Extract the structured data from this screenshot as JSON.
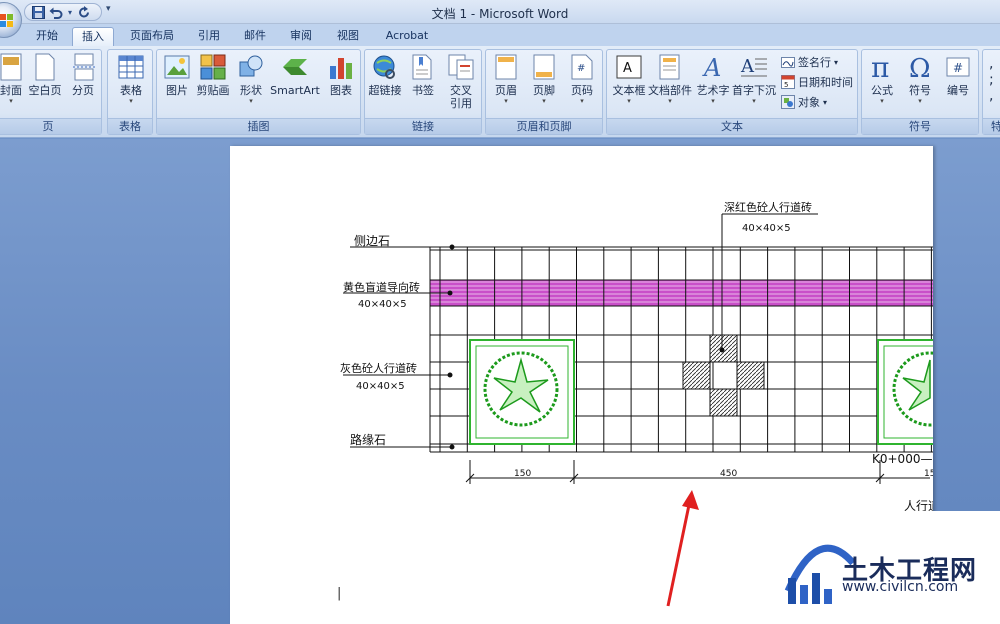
{
  "window": {
    "title": "文档 1 - Microsoft Word"
  },
  "quick_access": {
    "save": "save-icon",
    "undo": "undo-icon",
    "redo": "redo-icon",
    "more": "▾"
  },
  "tabs": [
    "开始",
    "插入",
    "页面布局",
    "引用",
    "邮件",
    "审阅",
    "视图",
    "Acrobat"
  ],
  "active_tab": "插入",
  "ribbon": {
    "pages": {
      "label": "页",
      "buttons": [
        "封面",
        "空白页",
        "分页"
      ]
    },
    "tables": {
      "label": "表格",
      "buttons": [
        "表格"
      ]
    },
    "illustrations": {
      "label": "插图",
      "buttons": [
        "图片",
        "剪贴画",
        "形状",
        "SmartArt",
        "图表"
      ]
    },
    "links": {
      "label": "链接",
      "buttons": [
        "超链接",
        "书签",
        "交叉",
        "引用"
      ]
    },
    "header_footer": {
      "label": "页眉和页脚",
      "buttons": [
        "页眉",
        "页脚",
        "页码"
      ]
    },
    "text": {
      "label": "文本",
      "buttons": [
        "文本框",
        "文档部件",
        "艺术字",
        "首字下沉"
      ],
      "small": [
        "签名行",
        "日期和时间",
        "对象"
      ]
    },
    "symbols": {
      "label": "符号",
      "buttons": [
        "公式",
        "符号",
        "编号"
      ]
    },
    "special": {
      "label": "特"
    }
  },
  "drawing": {
    "labels": {
      "curb_side": "侧边石",
      "yellow_tile": "黄色盲道导向砖",
      "yellow_tile_size": "40×40×5",
      "gray_tile": "灰色砼人行道砖",
      "gray_tile_size": "40×40×5",
      "curb_road": "路缘石",
      "dark_tile": "深红色砼人行道砖",
      "dark_tile_size": "40×40×5",
      "station": "K0+000—",
      "dim1": "150",
      "dim2": "450",
      "dim3": "15",
      "footer_note": "人行道"
    }
  },
  "watermark": {
    "title": "土木工程网",
    "url": "www.civilcn.com"
  }
}
